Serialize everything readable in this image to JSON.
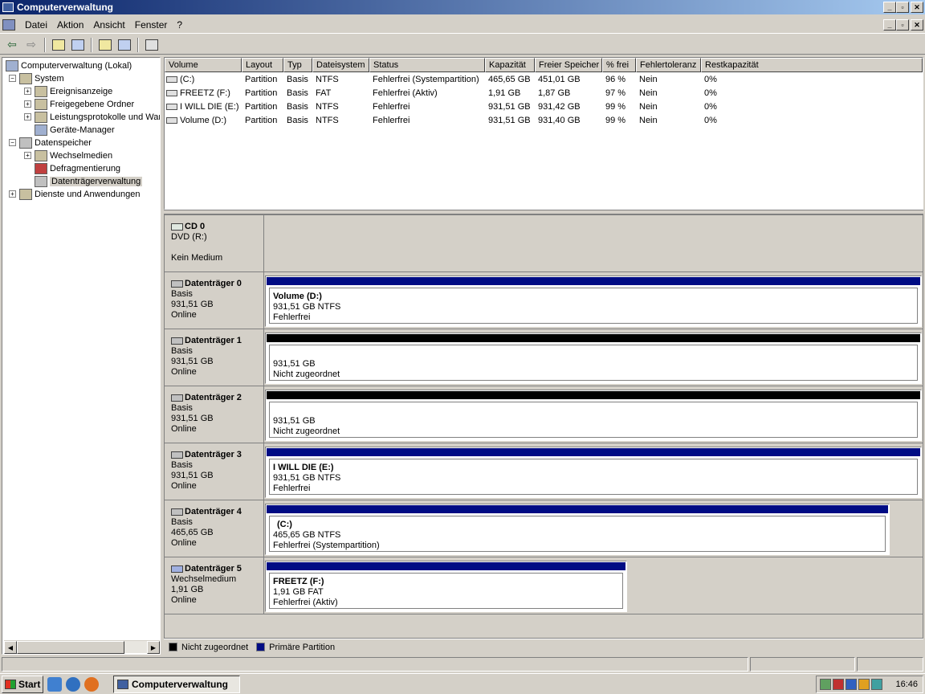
{
  "window": {
    "title": "Computerverwaltung"
  },
  "menu": [
    {
      "label": "Datei"
    },
    {
      "label": "Aktion"
    },
    {
      "label": "Ansicht"
    },
    {
      "label": "Fenster"
    },
    {
      "label": "?"
    }
  ],
  "tree": {
    "items": [
      {
        "label": "Computerverwaltung (Lokal)"
      },
      {
        "label": "System"
      },
      {
        "label": "Ereignisanzeige"
      },
      {
        "label": "Freigegebene Ordner"
      },
      {
        "label": "Leistungsprotokolle und Warnungen"
      },
      {
        "label": "Geräte-Manager"
      },
      {
        "label": "Datenspeicher"
      },
      {
        "label": "Wechselmedien"
      },
      {
        "label": "Defragmentierung"
      },
      {
        "label": "Datenträgerverwaltung"
      },
      {
        "label": "Dienste und Anwendungen"
      }
    ]
  },
  "volumes": {
    "columns": [
      "Volume",
      "Layout",
      "Typ",
      "Dateisystem",
      "Status",
      "Kapazität",
      "Freier Speicher",
      "% frei",
      "Fehlertoleranz",
      "Restkapazität"
    ],
    "rows": [
      [
        "(C:)",
        "Partition",
        "Basis",
        "NTFS",
        "Fehlerfrei (Systempartition)",
        "465,65 GB",
        "451,01 GB",
        "96 %",
        "Nein",
        "0%"
      ],
      [
        "FREETZ (F:)",
        "Partition",
        "Basis",
        "FAT",
        "Fehlerfrei (Aktiv)",
        "1,91 GB",
        "1,87 GB",
        "97 %",
        "Nein",
        "0%"
      ],
      [
        "I WILL DIE (E:)",
        "Partition",
        "Basis",
        "NTFS",
        "Fehlerfrei",
        "931,51 GB",
        "931,42 GB",
        "99 %",
        "Nein",
        "0%"
      ],
      [
        "Volume (D:)",
        "Partition",
        "Basis",
        "NTFS",
        "Fehlerfrei",
        "931,51 GB",
        "931,40 GB",
        "99 %",
        "Nein",
        "0%"
      ]
    ]
  },
  "disks": {
    "cd": {
      "name": "CD 0",
      "l1": "DVD (R:)",
      "l3": "Kein Medium"
    },
    "d0": {
      "name": "Datenträger 0",
      "type": "Basis",
      "size": "931,51 GB",
      "state": "Online",
      "p_name": "Volume  (D:)",
      "p_size": "931,51 GB NTFS",
      "p_status": "Fehlerfrei"
    },
    "d1": {
      "name": "Datenträger 1",
      "type": "Basis",
      "size": "931,51 GB",
      "state": "Online",
      "p_size": "931,51 GB",
      "p_status": "Nicht zugeordnet"
    },
    "d2": {
      "name": "Datenträger 2",
      "type": "Basis",
      "size": "931,51 GB",
      "state": "Online",
      "p_size": "931,51 GB",
      "p_status": "Nicht zugeordnet"
    },
    "d3": {
      "name": "Datenträger 3",
      "type": "Basis",
      "size": "931,51 GB",
      "state": "Online",
      "p_name": "I WILL DIE  (E:)",
      "p_size": "931,51 GB NTFS",
      "p_status": "Fehlerfrei"
    },
    "d4": {
      "name": "Datenträger 4",
      "type": "Basis",
      "size": "465,65 GB",
      "state": "Online",
      "p_name": "(C:)",
      "p_size": "465,65 GB NTFS",
      "p_status": "Fehlerfrei (Systempartition)"
    },
    "d5": {
      "name": "Datenträger 5",
      "type": "Wechselmedium",
      "size": "1,91 GB",
      "state": "Online",
      "p_name": "FREETZ  (F:)",
      "p_size": "1,91 GB FAT",
      "p_status": "Fehlerfrei (Aktiv)"
    }
  },
  "legend": {
    "unallocated": "Nicht zugeordnet",
    "primary": "Primäre Partition"
  },
  "colors": {
    "primary": "#000c84",
    "unallocated": "#000000"
  },
  "taskbar": {
    "start": "Start",
    "task": "Computerverwaltung",
    "clock": "16:46"
  }
}
